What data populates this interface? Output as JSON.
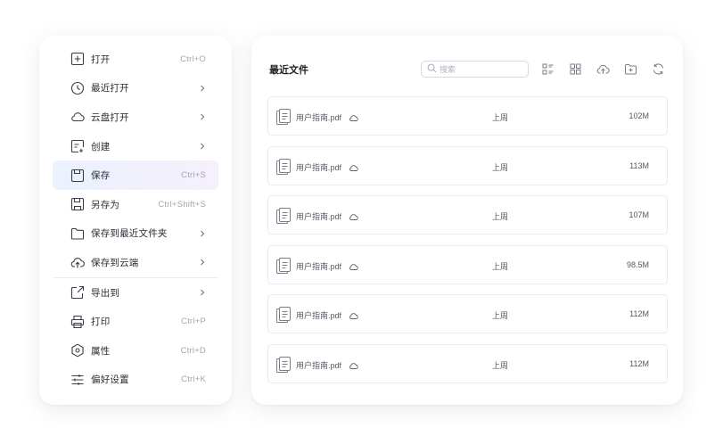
{
  "menu": {
    "items": [
      {
        "label": "打开",
        "shortcut": "Ctrl+O",
        "icon": "plus-square-icon",
        "submenu": false
      },
      {
        "label": "最近打开",
        "shortcut": "",
        "icon": "clock-icon",
        "submenu": true
      },
      {
        "label": "云盘打开",
        "shortcut": "",
        "icon": "cloud-icon",
        "submenu": true
      },
      {
        "label": "创建",
        "shortcut": "",
        "icon": "create-doc-icon",
        "submenu": true
      },
      {
        "label": "保存",
        "shortcut": "Ctrl+S",
        "icon": "save-icon",
        "submenu": false,
        "active": true
      },
      {
        "label": "另存为",
        "shortcut": "Ctrl+Shift+S",
        "icon": "save-as-icon",
        "submenu": false
      },
      {
        "label": "保存到最近文件夹",
        "shortcut": "",
        "icon": "folder-icon",
        "submenu": true
      },
      {
        "label": "保存到云端",
        "shortcut": "",
        "icon": "cloud-upload-icon",
        "submenu": true
      },
      {
        "label": "导出到",
        "shortcut": "",
        "icon": "export-icon",
        "submenu": true
      },
      {
        "label": "打印",
        "shortcut": "Ctrl+P",
        "icon": "printer-icon",
        "submenu": false
      },
      {
        "label": "属性",
        "shortcut": "Ctrl+D",
        "icon": "properties-icon",
        "submenu": false
      },
      {
        "label": "偏好设置",
        "shortcut": "Ctrl+K",
        "icon": "sliders-icon",
        "submenu": false
      }
    ]
  },
  "files_panel": {
    "title": "最近文件",
    "search": {
      "placeholder": "搜索",
      "value": ""
    },
    "toolbar": [
      "list-view-icon",
      "grid-view-icon",
      "upload-cloud-icon",
      "new-folder-icon",
      "refresh-icon"
    ],
    "files": [
      {
        "name": "用户指南.pdf",
        "time": "上周",
        "size": "102M"
      },
      {
        "name": "用户指南.pdf",
        "time": "上周",
        "size": "113M"
      },
      {
        "name": "用户指南.pdf",
        "time": "上周",
        "size": "107M"
      },
      {
        "name": "用户指南.pdf",
        "time": "上周",
        "size": "98.5M"
      },
      {
        "name": "用户指南.pdf",
        "time": "上周",
        "size": "112M"
      },
      {
        "name": "用户指南.pdf",
        "time": "上周",
        "size": "112M"
      }
    ]
  },
  "colors": {
    "active_bg_start": "#eaf2fd",
    "active_bg_end": "#f6effc",
    "icon_stroke": "#3b3d45",
    "muted_text": "#a3a6b0"
  }
}
